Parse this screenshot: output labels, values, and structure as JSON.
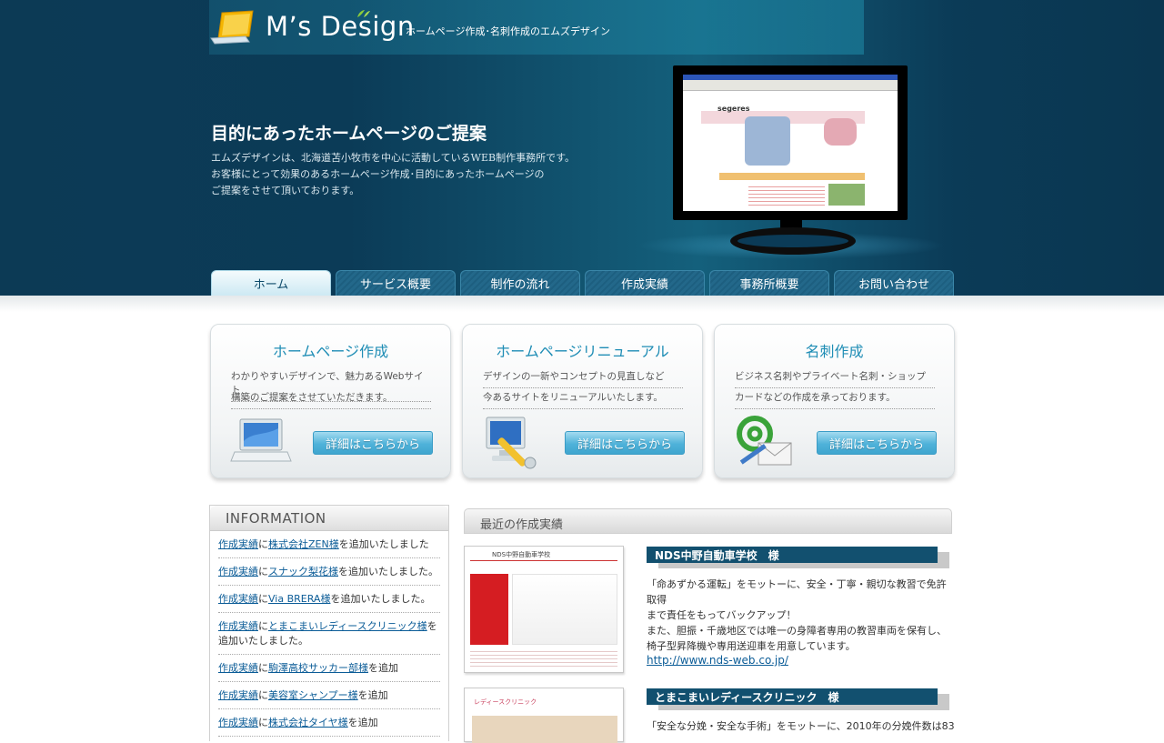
{
  "site": {
    "logo_text": "M’s Design",
    "tagline": "ホームページ作成･名刺作成のエムズデザイン"
  },
  "hero": {
    "title": "目的にあったホームページのご提案",
    "lines": [
      "エムズデザインは、北海道苫小牧市を中心に活動しているWEB制作事務所です。",
      "お客様にとって効果のあるホームページ作成･目的にあったホームページの",
      "ご提案をさせて頂いております。"
    ],
    "screen_brand": "segeres"
  },
  "nav": {
    "items": [
      {
        "label": "ホーム",
        "active": true
      },
      {
        "label": "サービス概要",
        "active": false
      },
      {
        "label": "制作の流れ",
        "active": false
      },
      {
        "label": "作成実績",
        "active": false
      },
      {
        "label": "事務所概要",
        "active": false
      },
      {
        "label": "お問い合わせ",
        "active": false
      }
    ]
  },
  "services": [
    {
      "title": "ホームページ作成",
      "line1": "わかりやすいデザインで、魅力あるWebサイト",
      "line2": "構築のご提案をさせていただきます。",
      "button": "詳細はこちらから",
      "icon": "laptop-icon"
    },
    {
      "title": "ホームページリニューアル",
      "line1": "デザインの一新やコンセプトの見直しなど",
      "line2": "今あるサイトをリニューアルいたします。",
      "button": "詳細はこちらから",
      "icon": "monitor-wrench-icon"
    },
    {
      "title": "名刺作成",
      "line1": "ビジネス名刺やプライベート名刺・ショップ",
      "line2": "カードなどの作成を承っております。",
      "button": "詳細はこちらから",
      "icon": "email-at-icon"
    }
  ],
  "information": {
    "heading": "INFORMATION",
    "items": [
      {
        "prefix": "作成実績",
        "mid": "に",
        "link": "株式会社ZEN様",
        "suffix": "を追加いたしました"
      },
      {
        "prefix": "作成実績",
        "mid": "に",
        "link": "スナック梨花様",
        "suffix": "を追加いたしました。"
      },
      {
        "prefix": "作成実績",
        "mid": "に",
        "link": "Via BRERA様",
        "suffix": "を追加いたしました。"
      },
      {
        "prefix": "作成実績",
        "mid": "に",
        "link": "とまこまいレディースクリニック様",
        "suffix": "を追加いたしました。"
      },
      {
        "prefix": "作成実績",
        "mid": "に",
        "link": "駒澤高校サッカー部様",
        "suffix": "を追加"
      },
      {
        "prefix": "作成実績",
        "mid": "に",
        "link": "美容室シャンプー様",
        "suffix": "を追加"
      },
      {
        "prefix": "作成実績",
        "mid": "に",
        "link": "株式会社タイヤ様",
        "suffix": "を追加"
      }
    ]
  },
  "works": {
    "heading": "最近の作成実績",
    "items": [
      {
        "title": "NDS中野自動車学校　様",
        "thumb_label": "NDS中野自動車学校",
        "desc": [
          "「命あずかる運転」をモットーに、安全・丁寧・親切な教習で免許取得",
          "まで責任をもってバックアップ！",
          "また、胆振・千歳地区では唯一の身障者専用の教習車両を保有し、",
          "椅子型昇降機や専用送迎車を用意しています。"
        ],
        "url": "http://www.nds-web.co.jp/"
      },
      {
        "title": "とまこまいレディースクリニック　様",
        "thumb_label": "レディースクリニック",
        "desc": [
          "「安全な分娩・安全な手術」をモットーに、2010年の分娩件数は83"
        ]
      }
    ]
  }
}
